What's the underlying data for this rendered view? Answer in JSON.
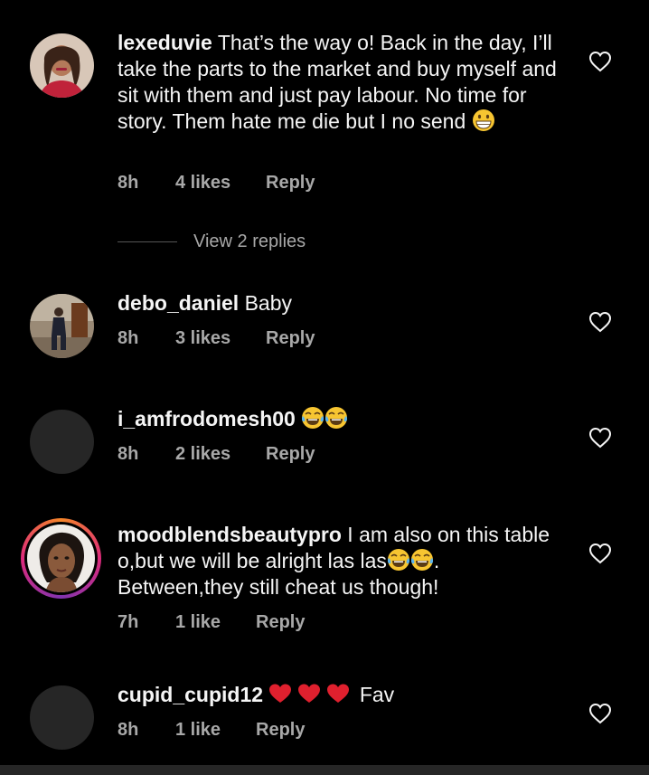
{
  "comments": [
    {
      "username": "lexeduvie",
      "text": " That’s the way o! Back in the day, I’ll take the parts to the market and buy myself and sit with them and just pay labour. No time for story. Them hate me die but I no send ",
      "time": "8h",
      "likes": "4 likes",
      "reply": "Reply",
      "view_replies": "View 2 replies",
      "emoji": "grinning-face"
    },
    {
      "username": "debo_daniel",
      "text": " Baby",
      "time": "8h",
      "likes": "3 likes",
      "reply": "Reply"
    },
    {
      "username": "i_amfrodomesh00",
      "text": " ",
      "time": "8h",
      "likes": "2 likes",
      "reply": "Reply",
      "emoji": "tears-of-joy x2"
    },
    {
      "username": "moodblendsbeautypro",
      "text_a": " I am also on this table o,but we will be alright las las",
      "text_b": ". Between,they still cheat us though!",
      "time": "7h",
      "likes": "1 like",
      "reply": "Reply",
      "emoji": "tears-of-joy x2"
    },
    {
      "username": "cupid_cupid12",
      "text": " Fav",
      "time": "8h",
      "likes": "1 like",
      "reply": "Reply",
      "emoji": "red-heart x3"
    }
  ],
  "colors": {
    "background": "#000000",
    "text": "#f5f5f5",
    "meta": "#a8a8a8",
    "placeholder_avatar": "#262626"
  },
  "icons": [
    "heart-outline-icon",
    "grinning-face-emoji",
    "tears-of-joy-emoji",
    "red-heart-emoji"
  ]
}
